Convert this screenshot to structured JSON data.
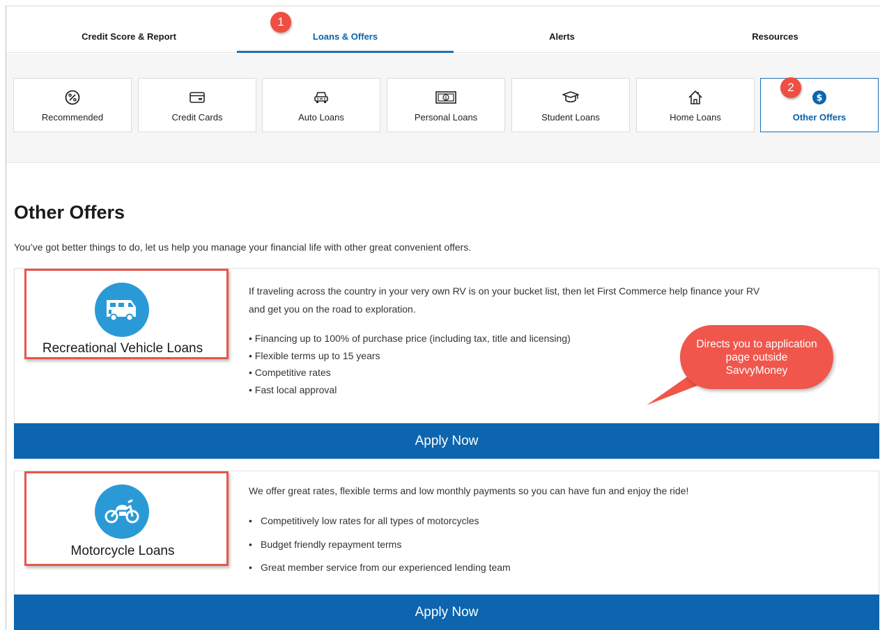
{
  "top_nav": {
    "tabs": [
      {
        "label": "Credit Score & Report"
      },
      {
        "label": "Loans & Offers",
        "active": true
      },
      {
        "label": "Alerts"
      },
      {
        "label": "Resources"
      }
    ]
  },
  "annotations": {
    "step1": "1",
    "step2": "2",
    "speech": "Directs you to application page outside SavvyMoney"
  },
  "categories": [
    {
      "label": "Recommended",
      "icon": "percent-badge-icon"
    },
    {
      "label": "Credit Cards",
      "icon": "credit-card-icon"
    },
    {
      "label": "Auto Loans",
      "icon": "car-icon"
    },
    {
      "label": "Personal Loans",
      "icon": "dollar-bill-icon"
    },
    {
      "label": "Student Loans",
      "icon": "graduation-cap-icon"
    },
    {
      "label": "Home Loans",
      "icon": "house-icon"
    },
    {
      "label": "Other Offers",
      "icon": "dollar-circle-icon",
      "active": true
    }
  ],
  "page": {
    "title": "Other Offers",
    "intro": "You’ve got better things to do, let us help you manage your financial life with other great convenient offers."
  },
  "offers": [
    {
      "name": "Recreational Vehicle Loans",
      "icon": "rv-icon",
      "description_line1": "If traveling across the country in your very own RV is on your bucket list, then let First Commerce help finance your RV",
      "description_line2": "and get you on the road to exploration.",
      "bullets": [
        "Financing up to 100% of purchase price (including tax, title and licensing)",
        "Flexible terms up to 15 years",
        "Competitive rates",
        "Fast local approval"
      ],
      "button": "Apply Now"
    },
    {
      "name": "Motorcycle Loans",
      "icon": "motorcycle-icon",
      "description_line1": "We offer great rates, flexible terms and low monthly payments so you can have fun and enjoy the ride!",
      "bullets": [
        "Competitively low rates for all types of motorcycles",
        "Budget friendly repayment terms",
        "Great member service from our experienced lending team"
      ],
      "button": "Apply Now"
    }
  ],
  "colors": {
    "accent_blue": "#0c65ae",
    "icon_blue": "#2a9ad6",
    "annotation_red": "#ee4f42"
  }
}
